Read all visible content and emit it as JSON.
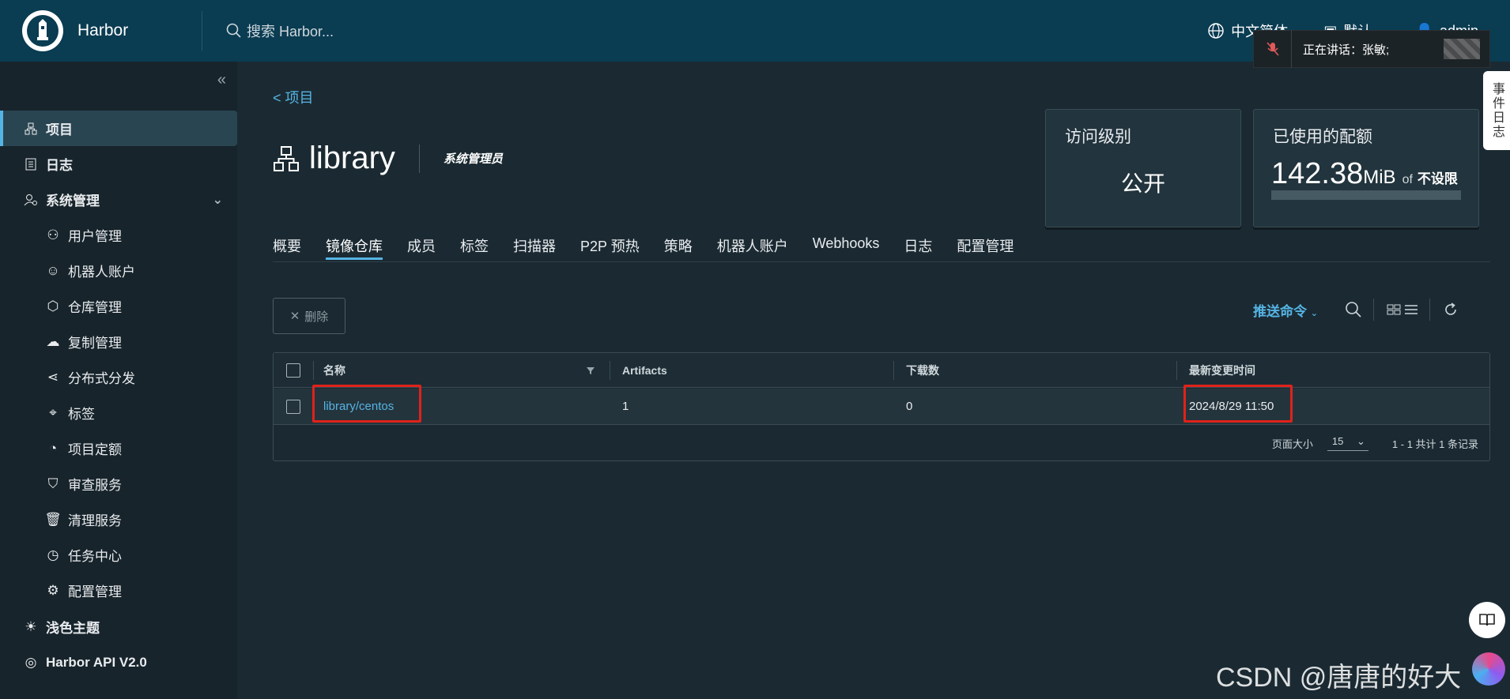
{
  "header": {
    "app_name": "Harbor",
    "search_placeholder": "搜索 Harbor...",
    "language": "中文简体",
    "theme_menu": "默认",
    "user": "admin"
  },
  "meeting": {
    "speaking_label": "正在讲话：张敏;"
  },
  "event_tab": "事件日志",
  "sidebar": {
    "items": [
      {
        "label": "项目",
        "icon": "projects-icon",
        "level": "top",
        "active": true
      },
      {
        "label": "日志",
        "icon": "logs-icon",
        "level": "top"
      },
      {
        "label": "系统管理",
        "icon": "admin-icon",
        "level": "top",
        "expanded": true
      },
      {
        "label": "用户管理",
        "icon": "users-icon",
        "level": "sub"
      },
      {
        "label": "机器人账户",
        "icon": "robot-icon",
        "level": "sub"
      },
      {
        "label": "仓库管理",
        "icon": "registry-icon",
        "level": "sub"
      },
      {
        "label": "复制管理",
        "icon": "replication-icon",
        "level": "sub"
      },
      {
        "label": "分布式分发",
        "icon": "share-icon",
        "level": "sub"
      },
      {
        "label": "标签",
        "icon": "tag-icon",
        "level": "sub"
      },
      {
        "label": "项目定额",
        "icon": "quota-icon",
        "level": "sub"
      },
      {
        "label": "审查服务",
        "icon": "shield-icon",
        "level": "sub"
      },
      {
        "label": "清理服务",
        "icon": "trash-icon",
        "level": "sub"
      },
      {
        "label": "任务中心",
        "icon": "dashboard-icon",
        "level": "sub"
      },
      {
        "label": "配置管理",
        "icon": "gear-icon",
        "level": "sub"
      }
    ],
    "bottom": [
      {
        "label": "浅色主题",
        "icon": "sun-icon"
      },
      {
        "label": "Harbor API V2.0",
        "icon": "api-icon"
      }
    ]
  },
  "page": {
    "back_label": "<  项目",
    "project_name": "library",
    "role": "系统管理员",
    "access_card": {
      "label": "访问级别",
      "value": "公开"
    },
    "quota_card": {
      "label": "已使用的配额",
      "used": "142.38",
      "unit": "MiB",
      "of": "of",
      "limit": "不设限",
      "used_fraction": 0
    }
  },
  "tabs": [
    {
      "label": "概要"
    },
    {
      "label": "镜像仓库",
      "active": true
    },
    {
      "label": "成员"
    },
    {
      "label": "标签"
    },
    {
      "label": "扫描器"
    },
    {
      "label": "P2P 预热"
    },
    {
      "label": "策略"
    },
    {
      "label": "机器人账户"
    },
    {
      "label": "Webhooks"
    },
    {
      "label": "日志"
    },
    {
      "label": "配置管理"
    }
  ],
  "actions": {
    "delete_label": "删除",
    "push_command": "推送命令"
  },
  "table": {
    "columns": [
      "名称",
      "Artifacts",
      "下载数",
      "最新变更时间"
    ],
    "rows": [
      {
        "name": "library/centos",
        "artifacts": "1",
        "pulls": "0",
        "updated": "2024/8/29 11:50"
      }
    ],
    "page_size_label": "页面大小",
    "page_size": "15",
    "summary": "1 - 1 共计 1 条记录"
  },
  "watermark": "CSDN @唐唐的好大",
  "colors": {
    "header_bg": "#0a3c52",
    "sidebar_bg": "#17242b",
    "main_bg": "#1b2a32",
    "accent": "#55b4e4",
    "highlight_box": "#e0221a"
  }
}
